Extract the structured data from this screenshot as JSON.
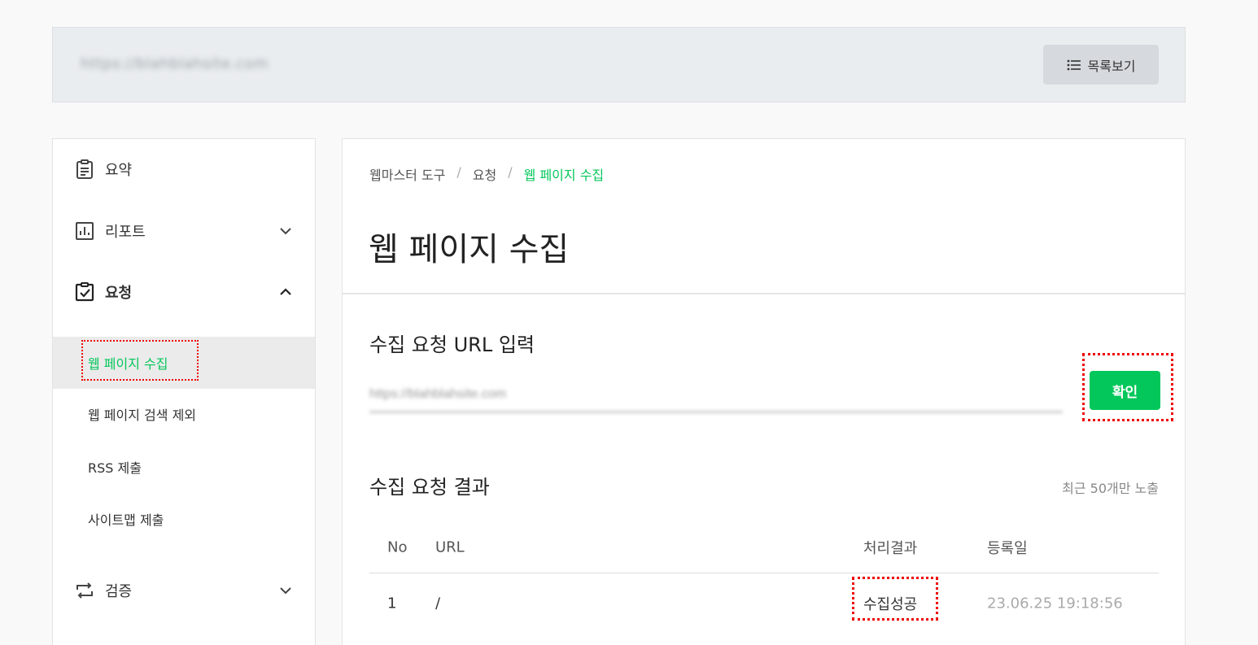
{
  "topbar": {
    "site_url": "https://blahblahsite.com",
    "list_button": "목록보기"
  },
  "sidebar": {
    "items": [
      {
        "label": "요약"
      },
      {
        "label": "리포트"
      },
      {
        "label": "요청"
      },
      {
        "label": "검증"
      }
    ],
    "sub_items": [
      {
        "label": "웹 페이지 수집"
      },
      {
        "label": "웹 페이지 검색 제외"
      },
      {
        "label": "RSS 제출"
      },
      {
        "label": "사이트맵 제출"
      }
    ]
  },
  "breadcrumb": {
    "root": "웹마스터 도구",
    "parent": "요청",
    "current": "웹 페이지 수집"
  },
  "page": {
    "title": "웹 페이지 수집"
  },
  "request": {
    "section_title": "수집 요청 URL 입력",
    "input_value": "https://blahblahsite.com",
    "confirm_button": "확인"
  },
  "results": {
    "section_title": "수집 요청 결과",
    "note": "최근 50개만 노출",
    "headers": {
      "no": "No",
      "url": "URL",
      "result": "처리결과",
      "date": "등록일"
    },
    "rows": [
      {
        "no": "1",
        "url": "/",
        "result": "수집성공",
        "date": "23.06.25 19:18:56"
      }
    ]
  },
  "colors": {
    "accent": "#03c75a",
    "highlight": "#e00000"
  }
}
